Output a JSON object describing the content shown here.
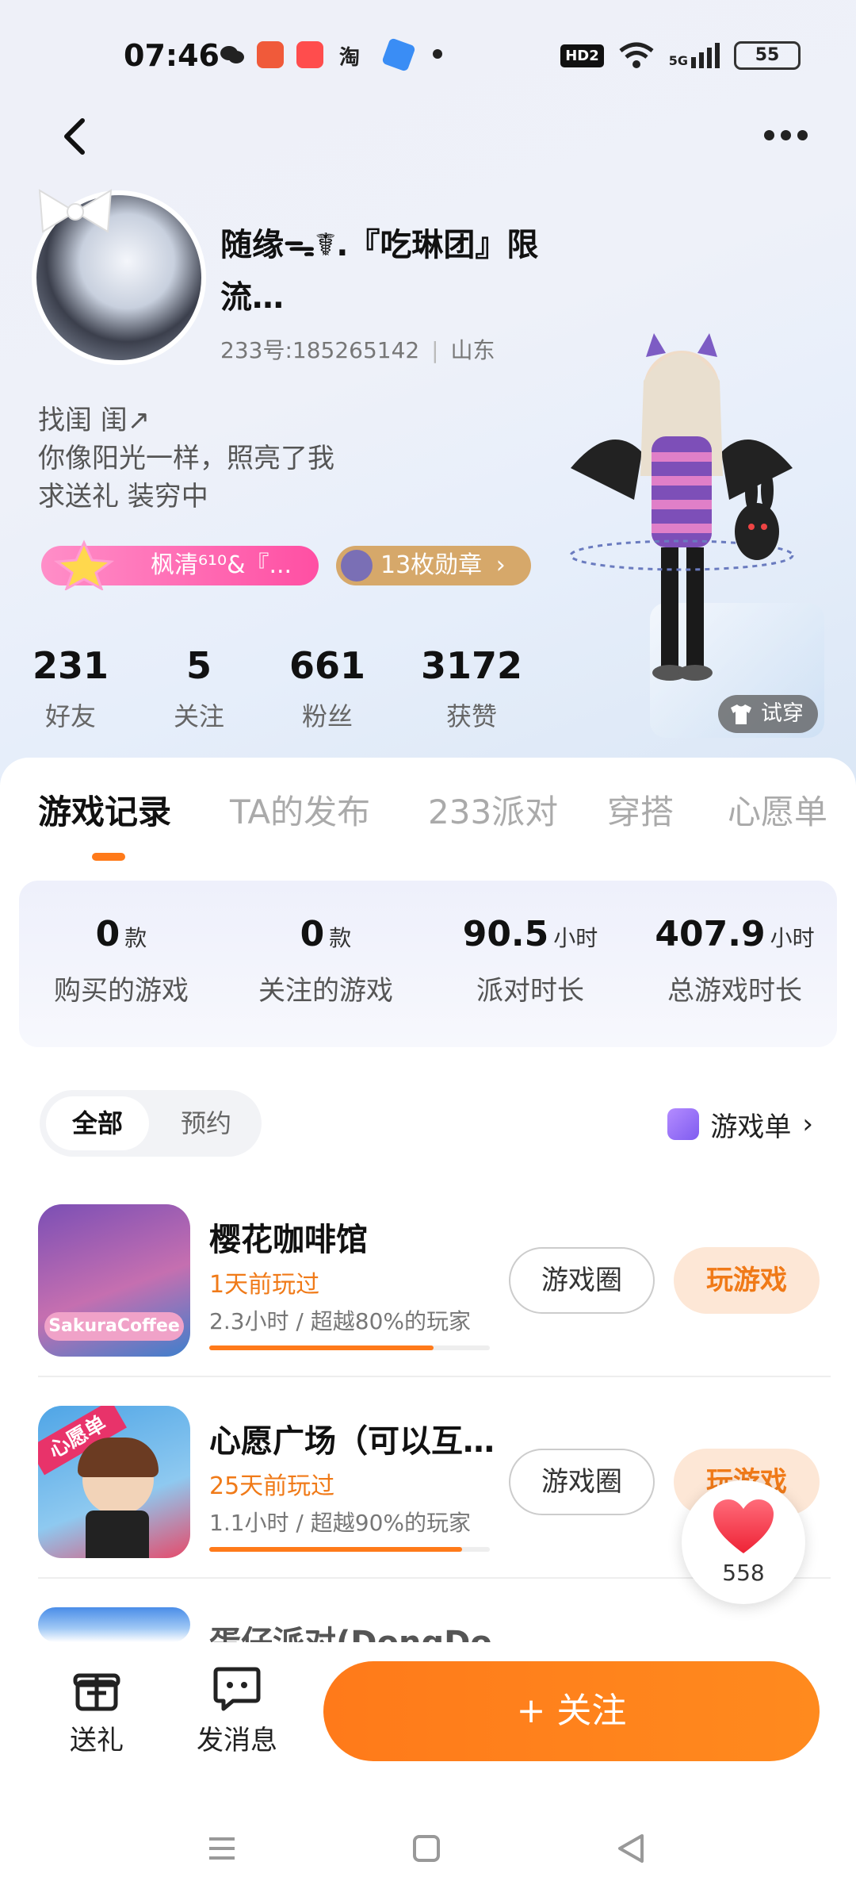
{
  "status_bar": {
    "time": "07:46",
    "network": "5G",
    "battery": "55",
    "hd_label": "HD2",
    "shop_label": "淘"
  },
  "profile": {
    "name": "随缘ᯓ☤.『吃琳团』限流…",
    "id_line": "233号:185265142",
    "location": "山东",
    "bio": [
      "找闺 闺↗",
      "你像阳光一样，照亮了我",
      "求送礼 装穷中"
    ],
    "badge_group": "枫清⁶¹⁰&『...",
    "badge_medals": "13枚勋章",
    "try_on": "试穿"
  },
  "stats": [
    {
      "value": "231",
      "label": "好友"
    },
    {
      "value": "5",
      "label": "关注"
    },
    {
      "value": "661",
      "label": "粉丝"
    },
    {
      "value": "3172",
      "label": "获赞"
    }
  ],
  "tabs": [
    "游戏记录",
    "TA的发布",
    "233派对",
    "穿搭",
    "心愿单"
  ],
  "summary": [
    {
      "value": "0",
      "unit": "款",
      "label": "购买的游戏"
    },
    {
      "value": "0",
      "unit": "款",
      "label": "关注的游戏"
    },
    {
      "value": "90.5",
      "unit": "小时",
      "label": "派对时长"
    },
    {
      "value": "407.9",
      "unit": "小时",
      "label": "总游戏时长"
    }
  ],
  "filters": {
    "all": "全部",
    "reserve": "预约",
    "game_list": "游戏单"
  },
  "games": [
    {
      "title": "樱花咖啡馆",
      "played": "1天前玩过",
      "sub": "2.3小时 / 超越80%的玩家",
      "progress": 0.8,
      "circle": "游戏圈",
      "play": "玩游戏",
      "icon_text": "SakuraCoffee"
    },
    {
      "title": "心愿广场（可以互…",
      "played": "25天前玩过",
      "sub": "1.1小时 / 超越90%的玩家",
      "progress": 0.9,
      "circle": "游戏圈",
      "play": "玩游戏",
      "icon_text": "心愿单"
    },
    {
      "title": "蛋仔派对(DongDo…",
      "played": "",
      "sub": "",
      "progress": 0,
      "circle": "",
      "play": ""
    }
  ],
  "like_count": "558",
  "bottom": {
    "gift": "送礼",
    "message": "发消息",
    "follow": "+ 关注"
  },
  "colors": {
    "accent": "#ff7a1a",
    "badge_pink": "#ff4fa3",
    "medal_gold": "#d6a86a"
  }
}
